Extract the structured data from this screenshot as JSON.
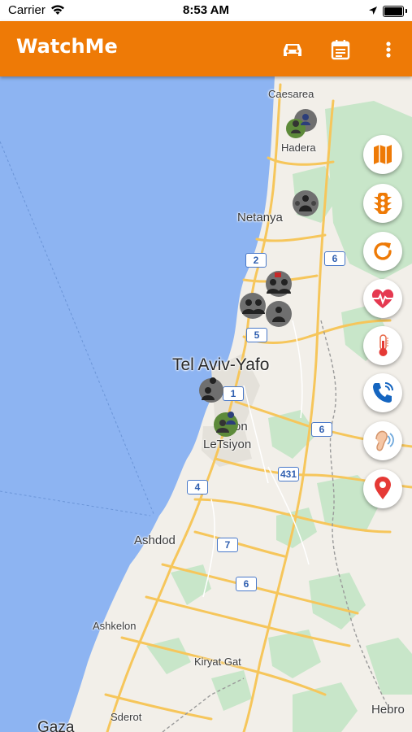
{
  "status_bar": {
    "carrier": "Carrier",
    "time": "8:53 AM"
  },
  "app_bar": {
    "title": "WatchMe",
    "color": "#ee7a06"
  },
  "map": {
    "cities": {
      "caesarea": "Caesarea",
      "hadera": "Hadera",
      "netanya": "Netanya",
      "tel_aviv": "Tel Aviv-Yafo",
      "rishon_a": "on",
      "rishon_b": "LeTsiyon",
      "ashdod": "Ashdod",
      "ashkelon": "Ashkelon",
      "kiryat_gat": "Kiryat Gat",
      "sderot": "Sderot",
      "gaza": "Gaza",
      "hebron": "Hebro"
    },
    "roads": {
      "r2": "2",
      "r6a": "6",
      "r5": "5",
      "r1": "1",
      "r6b": "6",
      "r431": "431",
      "r4": "4",
      "r7": "7",
      "r6c": "6"
    }
  },
  "side_buttons": [
    {
      "icon": "map-icon"
    },
    {
      "icon": "traffic-light-icon"
    },
    {
      "icon": "refresh-icon"
    },
    {
      "icon": "heart-rate-icon"
    },
    {
      "icon": "thermometer-icon"
    },
    {
      "icon": "phone-call-icon"
    },
    {
      "icon": "hearing-icon"
    },
    {
      "icon": "location-pin-icon"
    }
  ],
  "colors": {
    "accent": "#ee7a06",
    "sea": "#8db4f2",
    "land": "#f2efe9",
    "park": "#c8e6c9",
    "road": "#f6c65b"
  }
}
